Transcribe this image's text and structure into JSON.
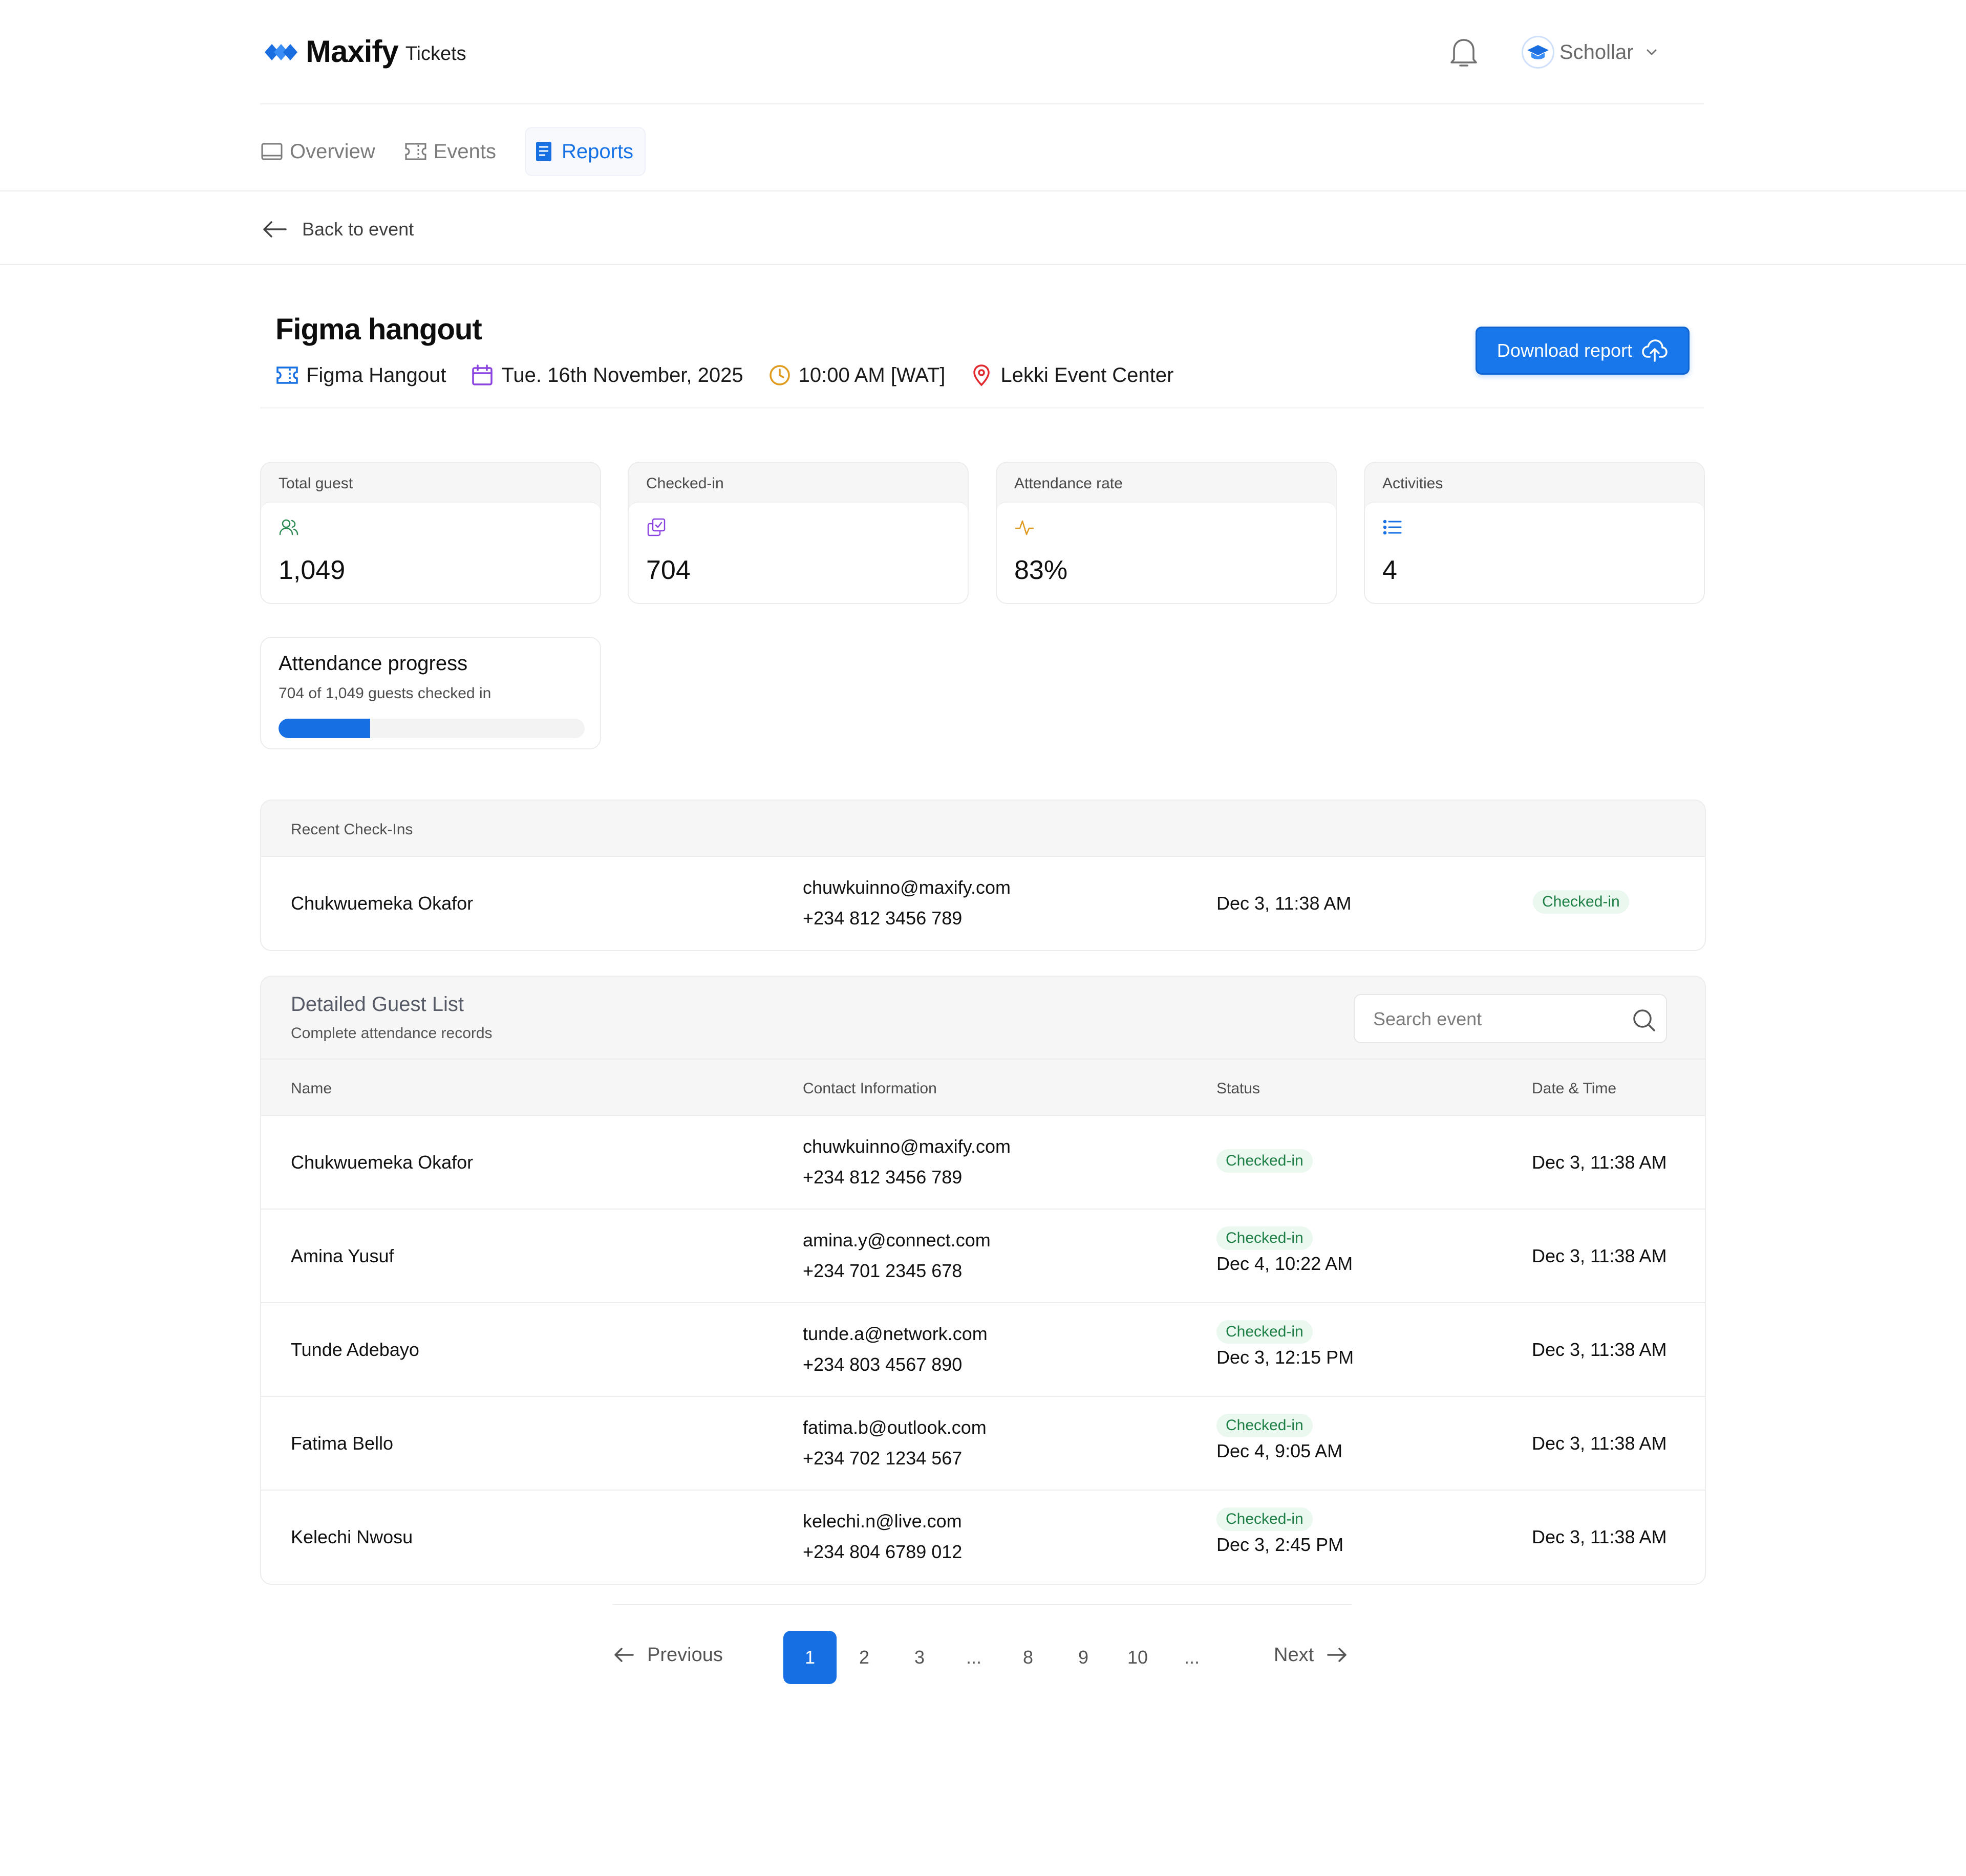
{
  "header": {
    "logo_name": "Maxify",
    "logo_sub": "Tickets",
    "notification_icon": "bell-icon",
    "user_name": "Schollar"
  },
  "tabs": [
    {
      "label": "Overview",
      "icon": "monitor-icon",
      "active": false
    },
    {
      "label": "Events",
      "icon": "ticket-icon",
      "active": false
    },
    {
      "label": "Reports",
      "icon": "document-icon",
      "active": true
    }
  ],
  "back_label": "Back to event",
  "event": {
    "title": "Figma hangout",
    "name": "Figma Hangout",
    "date": "Tue. 16th November, 2025",
    "time": "10:00 AM [WAT]",
    "location": "Lekki Event Center",
    "download_label": "Download report"
  },
  "stats": [
    {
      "label": "Total guest",
      "value": "1,049",
      "icon": "users-icon",
      "color": "#2e8a55"
    },
    {
      "label": "Checked-in",
      "value": "704",
      "icon": "copy-check-icon",
      "color": "#8a43e0"
    },
    {
      "label": "Attendance rate",
      "value": "83%",
      "icon": "activity-icon",
      "color": "#e09a1e"
    },
    {
      "label": "Activities",
      "value": "4",
      "icon": "list-icon",
      "color": "#1670e4"
    }
  ],
  "progress": {
    "title": "Attendance progress",
    "subtitle": "704 of 1,049 guests checked in",
    "fraction": 0.3
  },
  "recent": {
    "title": "Recent Check-Ins",
    "rows": [
      {
        "name": "Chukwuemeka Okafor",
        "email": "chuwkuinno@maxify.com",
        "phone": "+234 812 3456 789",
        "time": "Dec 3, 11:38 AM",
        "status": "Checked-in"
      }
    ]
  },
  "guest_list": {
    "title": "Detailed Guest List",
    "subtitle": "Complete attendance records",
    "search_placeholder": "Search event",
    "columns": {
      "name": "Name",
      "contact": "Contact Information",
      "status": "Status",
      "datetime": "Date & Time"
    },
    "rows": [
      {
        "name": "Chukwuemeka Okafor",
        "email": "chuwkuinno@maxify.com",
        "phone": "+234 812 3456 789",
        "status": "Checked-in",
        "status_time": "",
        "datetime": "Dec 3, 11:38 AM"
      },
      {
        "name": "Amina Yusuf",
        "email": "amina.y@connect.com",
        "phone": "+234 701 2345 678",
        "status": "Checked-in",
        "status_time": "Dec 4, 10:22 AM",
        "datetime": "Dec 3, 11:38 AM"
      },
      {
        "name": "Tunde Adebayo",
        "email": "tunde.a@network.com",
        "phone": "+234 803 4567 890",
        "status": "Checked-in",
        "status_time": "Dec 3, 12:15 PM",
        "datetime": "Dec 3, 11:38 AM"
      },
      {
        "name": "Fatima Bello",
        "email": "fatima.b@outlook.com",
        "phone": "+234 702 1234 567",
        "status": "Checked-in",
        "status_time": "Dec 4, 9:05 AM",
        "datetime": "Dec 3, 11:38 AM"
      },
      {
        "name": "Kelechi Nwosu",
        "email": "kelechi.n@live.com",
        "phone": "+234 804 6789 012",
        "status": "Checked-in",
        "status_time": "Dec 3, 2:45 PM",
        "datetime": "Dec 3, 11:38 AM"
      }
    ]
  },
  "pagination": {
    "previous": "Previous",
    "next": "Next",
    "pages": [
      "1",
      "2",
      "3",
      "...",
      "8",
      "9",
      "10",
      "..."
    ],
    "current": "1"
  },
  "colors": {
    "accent": "#1670e4",
    "success_bg": "#eaf8ef",
    "success_text": "#1d7f45"
  }
}
